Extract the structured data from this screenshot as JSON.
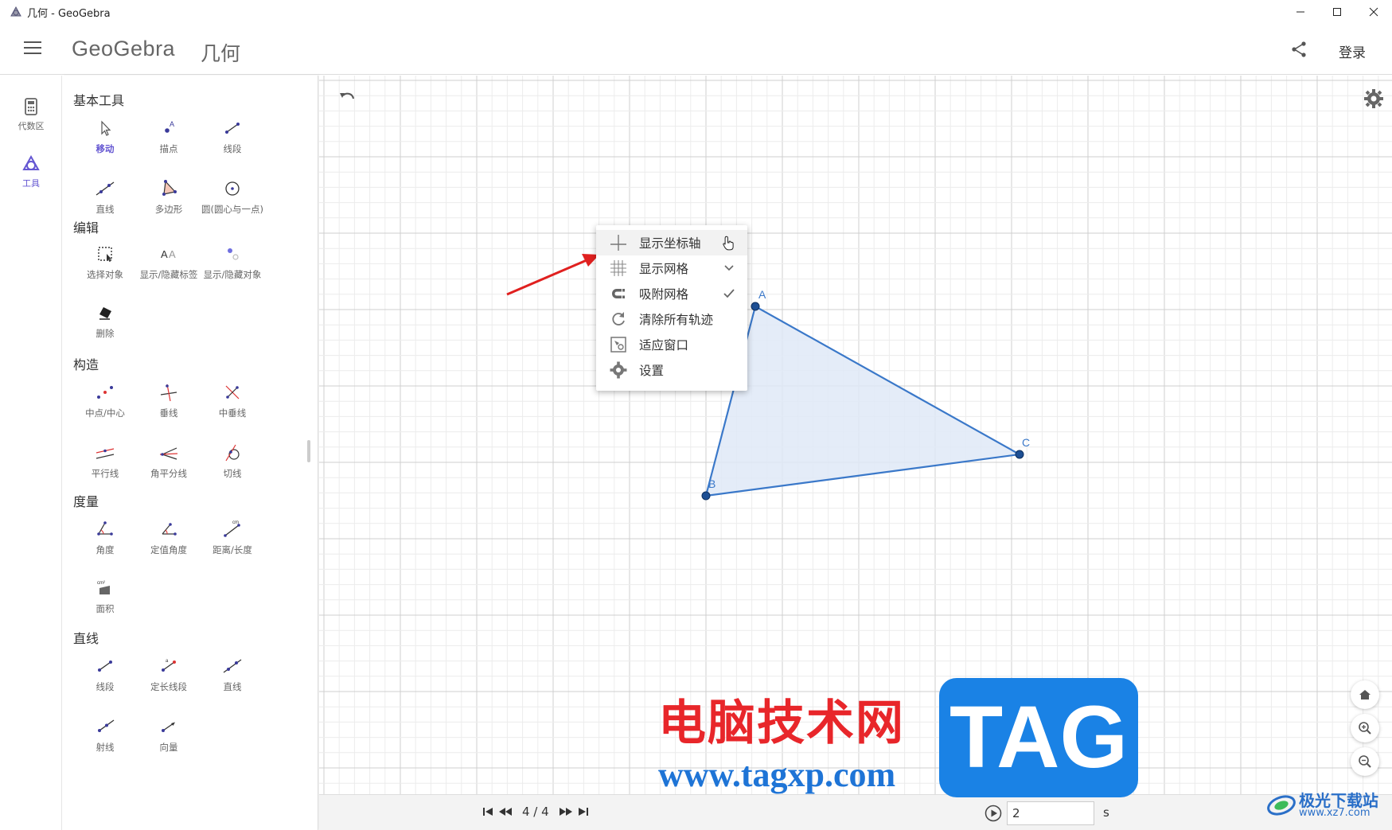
{
  "window": {
    "title": "几何 - GeoGebra"
  },
  "header": {
    "brand": "GeoGebra",
    "app_name": "几何",
    "login": "登录"
  },
  "rail": [
    {
      "label": "代数区",
      "icon": "calculator-icon"
    },
    {
      "label": "工具",
      "icon": "geometry-tools-icon"
    }
  ],
  "tools": {
    "sections": [
      {
        "title": "基本工具",
        "items": [
          "移动",
          "描点",
          "线段",
          "直线",
          "多边形",
          "圆(圆心与一点)"
        ]
      },
      {
        "title": "编辑",
        "items": [
          "选择对象",
          "显示/隐藏标签",
          "显示/隐藏对象",
          "删除"
        ]
      },
      {
        "title": "构造",
        "items": [
          "中点/中心",
          "垂线",
          "中垂线",
          "平行线",
          "角平分线",
          "切线"
        ]
      },
      {
        "title": "度量",
        "items": [
          "角度",
          "定值角度",
          "距离/长度",
          "面积"
        ]
      },
      {
        "title": "直线",
        "items": [
          "线段",
          "定长线段",
          "直线",
          "射线",
          "向量"
        ]
      }
    ]
  },
  "context_menu": {
    "items": [
      {
        "label": "显示坐标轴",
        "icon": "axes-icon"
      },
      {
        "label": "显示网格",
        "icon": "grid-icon",
        "right": "chevron-down-icon"
      },
      {
        "label": "吸附网格",
        "icon": "magnet-icon",
        "right": "checkmark-icon"
      },
      {
        "label": "清除所有轨迹",
        "icon": "refresh-icon"
      },
      {
        "label": "适应窗口",
        "icon": "fit-window-icon"
      },
      {
        "label": "设置",
        "icon": "gear-icon"
      }
    ]
  },
  "geometry": {
    "points": [
      {
        "label": "A"
      },
      {
        "label": "B"
      },
      {
        "label": "C"
      }
    ],
    "polygon_fill": "#dfe9f7",
    "stroke": "#3a78c9"
  },
  "bottom_bar": {
    "page_indicator": "4 / 4",
    "speed": "2",
    "unit": "s"
  },
  "watermarks": {
    "cn": "电脑技术网",
    "url": "www.tagxp.com",
    "tag": "TAG",
    "xz_cn": "极光下载站",
    "xz_url": "www.xz7.com"
  },
  "colors": {
    "accent": "#6557d2",
    "annotation_arrow": "#e0201f",
    "grid_minor": "#ececec",
    "grid_major": "#cfcfcf"
  }
}
